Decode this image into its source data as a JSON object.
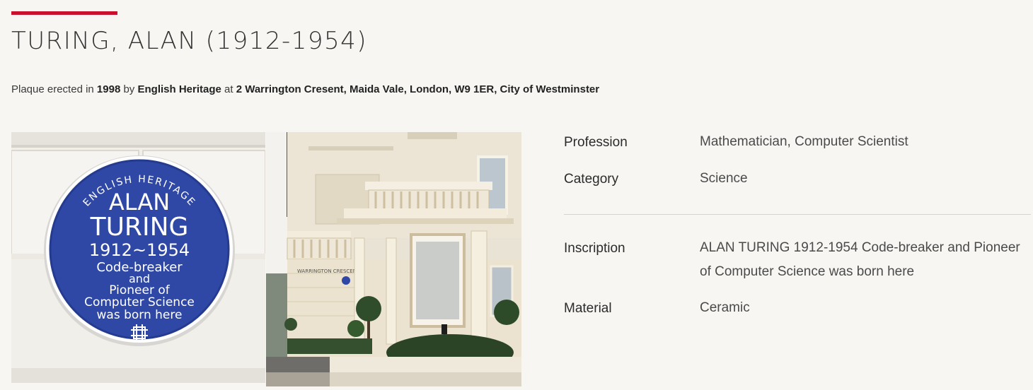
{
  "header": {
    "title": "TURING, ALAN (1912-1954)",
    "accent_color": "#c8102e"
  },
  "meta": {
    "prefix": "Plaque erected in",
    "year": "1998",
    "by_word": "by",
    "organisation": "English Heritage",
    "at_word": "at",
    "address": "2 Warrington Cresent, Maida Vale, London, W9 1ER, City of Westminster"
  },
  "plaque": {
    "ring_text": "ENGLISH HERITAGE",
    "line1": "ALAN",
    "line2": "TURING",
    "line3": "1912~1954",
    "line4": "Code-breaker",
    "line5": "and",
    "line6": "Pioneer of",
    "line7": "Computer Science",
    "line8": "was born here",
    "color": "#2f48a6"
  },
  "building": {
    "sign_text": "WARRINGTON CRESCENT"
  },
  "details": {
    "profession": {
      "label": "Profession",
      "value": "Mathematician, Computer Scientist"
    },
    "category": {
      "label": "Category",
      "value": "Science"
    },
    "inscription": {
      "label": "Inscription",
      "value": "ALAN TURING 1912-1954 Code-breaker and Pioneer of Computer Science was born here"
    },
    "material": {
      "label": "Material",
      "value": "Ceramic"
    }
  }
}
